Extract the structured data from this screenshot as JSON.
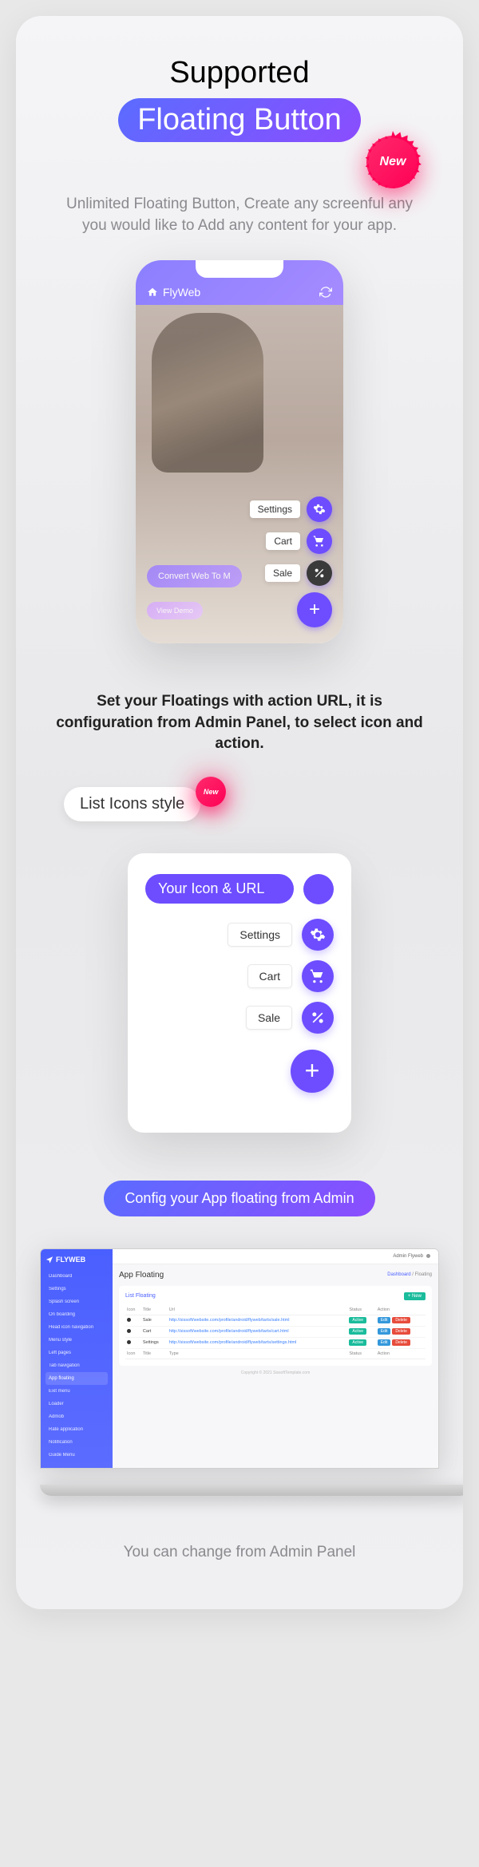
{
  "header": {
    "title1": "Supported",
    "title2": "Floating Button",
    "new_badge": "New"
  },
  "description": "Unlimited Floating Button, Create any screenful any you would like to Add any content for your app.",
  "phone": {
    "app_name": "FlyWeb",
    "fab_items": [
      {
        "label": "Settings",
        "icon": "gear"
      },
      {
        "label": "Cart",
        "icon": "cart"
      },
      {
        "label": "Sale",
        "icon": "percent"
      }
    ],
    "convert_label": "Convert Web To M",
    "view_label": "View Demo"
  },
  "section2_text": "Set your Floatings with action URL, it is configuration from Admin Panel, to select icon and action.",
  "list_icons_label": "List Icons style",
  "new_small": "New",
  "icon_card": {
    "header": "Your Icon & URL",
    "items": [
      {
        "label": "Settings",
        "icon": "gear"
      },
      {
        "label": "Cart",
        "icon": "cart"
      },
      {
        "label": "Sale",
        "icon": "percent"
      }
    ]
  },
  "config_pill": "Config your App floating from Admin",
  "admin": {
    "brand": "FLYWEB",
    "topbar": "Admin Flyweb",
    "nav": [
      "Dashboard",
      "Settings",
      "Splash screen",
      "On boarding",
      "Head icon navigation",
      "Menu style",
      "Left pages",
      "Tab navigation",
      "App floating",
      "Exit menu",
      "Loader",
      "Admob",
      "Rate application",
      "Notification",
      "Guide Menu"
    ],
    "page_title": "App Floating",
    "breadcrumb": {
      "root": "Dashboard",
      "current": "Floating"
    },
    "panel_title": "List Floating",
    "btn_new": "+ New",
    "table": {
      "headers": [
        "Icon",
        "Title",
        "Url",
        "Status",
        "Action"
      ],
      "headers2": [
        "Icon",
        "Title",
        "Type",
        "Status",
        "Action"
      ],
      "rows": [
        {
          "icon": "percent",
          "title": "Sale",
          "url": "http://sissoft/website.com/profile/android/flyweb/tarts/sale.html",
          "status": "Active"
        },
        {
          "icon": "bell",
          "title": "Cart",
          "url": "http://sissoft/website.com/profile/android/flyweb/tarts/cart.html",
          "status": "Active"
        },
        {
          "icon": "gear",
          "title": "Settings",
          "url": "http://sissoft/website.com/profile/android/flyweb/tarts/settings.html",
          "status": "Active"
        }
      ],
      "edit": "Edit",
      "delete": "Delete"
    },
    "footer": "Copyright © 2021 SissoftTemplate.com"
  },
  "footer_text": "You can change from Admin Panel"
}
